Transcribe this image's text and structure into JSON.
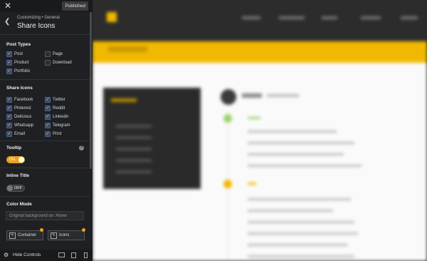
{
  "panel": {
    "close_icon": "close-icon",
    "published_label": "Published",
    "breadcrumb": "Customizing • General",
    "title": "Share Icons",
    "post_types": {
      "heading": "Post Types",
      "items": [
        {
          "label": "Post",
          "checked": true
        },
        {
          "label": "Page",
          "checked": false
        },
        {
          "label": "Product",
          "checked": true
        },
        {
          "label": "Download",
          "checked": false
        },
        {
          "label": "Portfolio",
          "checked": true
        }
      ]
    },
    "share_icons": {
      "heading": "Share Icons",
      "items": [
        {
          "label": "Facebook",
          "checked": true
        },
        {
          "label": "Twitter",
          "checked": true
        },
        {
          "label": "Pinterest",
          "checked": true
        },
        {
          "label": "Reddit",
          "checked": true
        },
        {
          "label": "Delicious",
          "checked": true
        },
        {
          "label": "Linkedin",
          "checked": true
        },
        {
          "label": "Whatsapp",
          "checked": true
        },
        {
          "label": "Telegram",
          "checked": true
        },
        {
          "label": "Email",
          "checked": true
        },
        {
          "label": "Print",
          "checked": true
        }
      ]
    },
    "tooltip": {
      "heading": "Tooltip",
      "toggle_label": "ON",
      "on": true,
      "help_glyph": "?"
    },
    "inline_title": {
      "heading": "Inline Title",
      "toggle_label": "OFF",
      "on": false
    },
    "color_mode": {
      "heading": "Color Mode",
      "select_value": "Original background on :Hover",
      "buttons": [
        {
          "label": "Container"
        },
        {
          "label": "Icons"
        }
      ]
    },
    "footer": {
      "hide_controls": "Hide Controls"
    },
    "accent_color": "#e8a21a"
  }
}
